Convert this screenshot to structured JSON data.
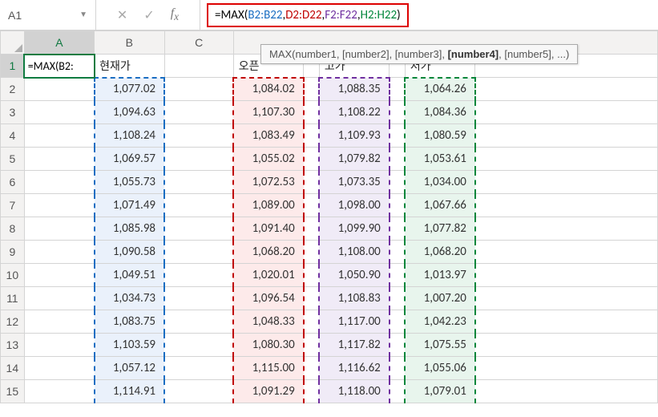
{
  "name_box": "A1",
  "formula": {
    "prefix": "=MAX(",
    "r1": "B2:B22",
    "r2": "D2:D22",
    "r3": "F2:F22",
    "r4": "H2:H22",
    "suffix": ")"
  },
  "tooltip": {
    "fn": "MAX(",
    "a1": "number1",
    "a2": ", [number2]",
    "a3": ", [number3], ",
    "a4": "[number4]",
    "a5": ", [number5], ...)"
  },
  "columns": [
    "A",
    "B",
    "C",
    "",
    "",
    "",
    "",
    "",
    ""
  ],
  "col_labels": {
    "A": "A",
    "B": "B",
    "C": "C"
  },
  "row_labels": [
    "1",
    "2",
    "3",
    "4",
    "5",
    "6",
    "7",
    "8",
    "9",
    "10",
    "11",
    "12",
    "13",
    "14",
    "15"
  ],
  "active_cell_display": "=MAX(B2:",
  "headers": {
    "b": "현재가",
    "d": "오픈",
    "f": "고가",
    "h": "저가"
  },
  "cols": {
    "b": [
      "1,077.02",
      "1,094.63",
      "1,108.24",
      "1,069.57",
      "1,055.73",
      "1,071.49",
      "1,085.98",
      "1,090.58",
      "1,049.51",
      "1,034.73",
      "1,083.75",
      "1,103.59",
      "1,057.12",
      "1,114.91"
    ],
    "d": [
      "1,084.02",
      "1,107.30",
      "1,083.49",
      "1,055.02",
      "1,072.53",
      "1,089.00",
      "1,091.40",
      "1,068.20",
      "1,020.01",
      "1,096.54",
      "1,048.33",
      "1,080.30",
      "1,115.00",
      "1,091.29"
    ],
    "f": [
      "1,088.35",
      "1,108.22",
      "1,109.93",
      "1,079.82",
      "1,073.35",
      "1,098.00",
      "1,099.90",
      "1,108.00",
      "1,050.90",
      "1,108.83",
      "1,117.00",
      "1,117.82",
      "1,116.62",
      "1,118.00"
    ],
    "h": [
      "1,064.26",
      "1,084.36",
      "1,080.59",
      "1,053.61",
      "1,034.00",
      "1,067.66",
      "1,077.82",
      "1,068.20",
      "1,013.97",
      "1,007.20",
      "1,042.23",
      "1,075.55",
      "1,055.06",
      "1,079.01"
    ]
  },
  "chart_data": {
    "type": "table",
    "title": "",
    "columns": [
      "현재가",
      "오픈",
      "고가",
      "저가"
    ],
    "rows_index": [
      2,
      3,
      4,
      5,
      6,
      7,
      8,
      9,
      10,
      11,
      12,
      13,
      14,
      15
    ],
    "series": [
      {
        "name": "현재가",
        "values": [
          1077.02,
          1094.63,
          1108.24,
          1069.57,
          1055.73,
          1071.49,
          1085.98,
          1090.58,
          1049.51,
          1034.73,
          1083.75,
          1103.59,
          1057.12,
          1114.91
        ]
      },
      {
        "name": "오픈",
        "values": [
          1084.02,
          1107.3,
          1083.49,
          1055.02,
          1072.53,
          1089.0,
          1091.4,
          1068.2,
          1020.01,
          1096.54,
          1048.33,
          1080.3,
          1115.0,
          1091.29
        ]
      },
      {
        "name": "고가",
        "values": [
          1088.35,
          1108.22,
          1109.93,
          1079.82,
          1073.35,
          1098.0,
          1099.9,
          1108.0,
          1050.9,
          1108.83,
          1117.0,
          1117.82,
          1116.62,
          1118.0
        ]
      },
      {
        "name": "저가",
        "values": [
          1064.26,
          1084.36,
          1080.59,
          1053.61,
          1034.0,
          1067.66,
          1077.82,
          1068.2,
          1013.97,
          1007.2,
          1042.23,
          1075.55,
          1055.06,
          1079.01
        ]
      }
    ]
  }
}
